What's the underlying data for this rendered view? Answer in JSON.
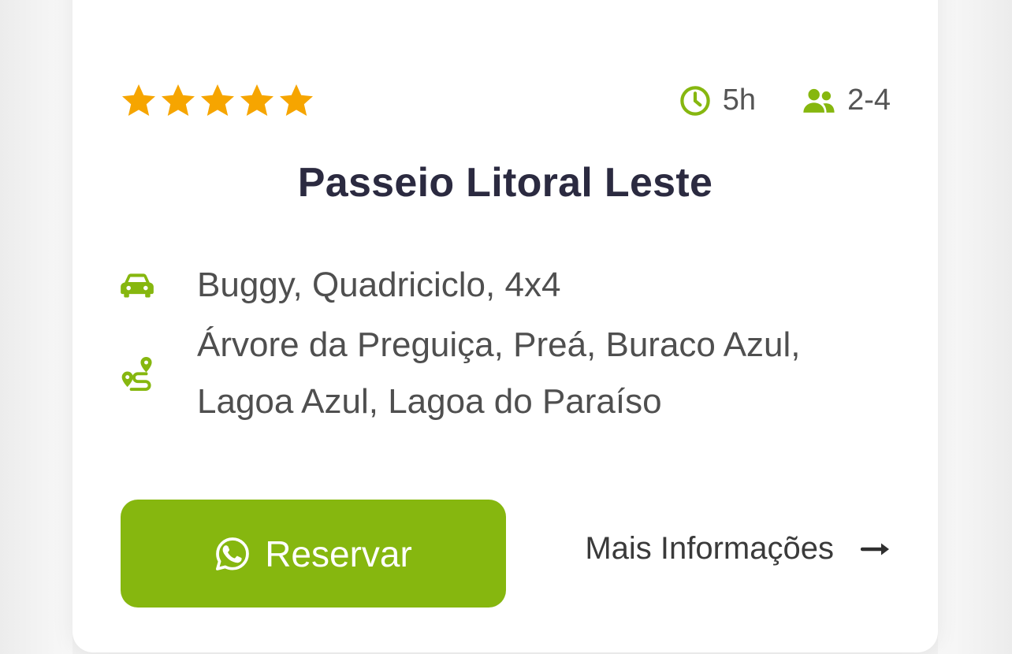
{
  "colors": {
    "accent_green": "#86b70f",
    "star": "#f6a500",
    "title": "#2b2a40",
    "body_text": "#4f4f4f"
  },
  "rating": {
    "stars": 5,
    "max": 5
  },
  "meta": {
    "duration": {
      "icon": "clock-icon",
      "value": "5h"
    },
    "people": {
      "icon": "users-icon",
      "value": "2-4"
    }
  },
  "tour": {
    "title": "Passeio Litoral Leste",
    "vehicles": {
      "icon": "car-icon",
      "text": "Buggy, Quadriciclo, 4x4"
    },
    "route": {
      "icon": "route-icon",
      "line1": "Árvore da Preguiça, Preá, Buraco Azul,",
      "line2": "Lagoa Azul, Lagoa do Paraíso"
    }
  },
  "actions": {
    "reserve": {
      "icon": "whatsapp-icon",
      "label": "Reservar"
    },
    "more_info": {
      "label": "Mais Informações",
      "icon": "arrow-right-icon"
    }
  }
}
